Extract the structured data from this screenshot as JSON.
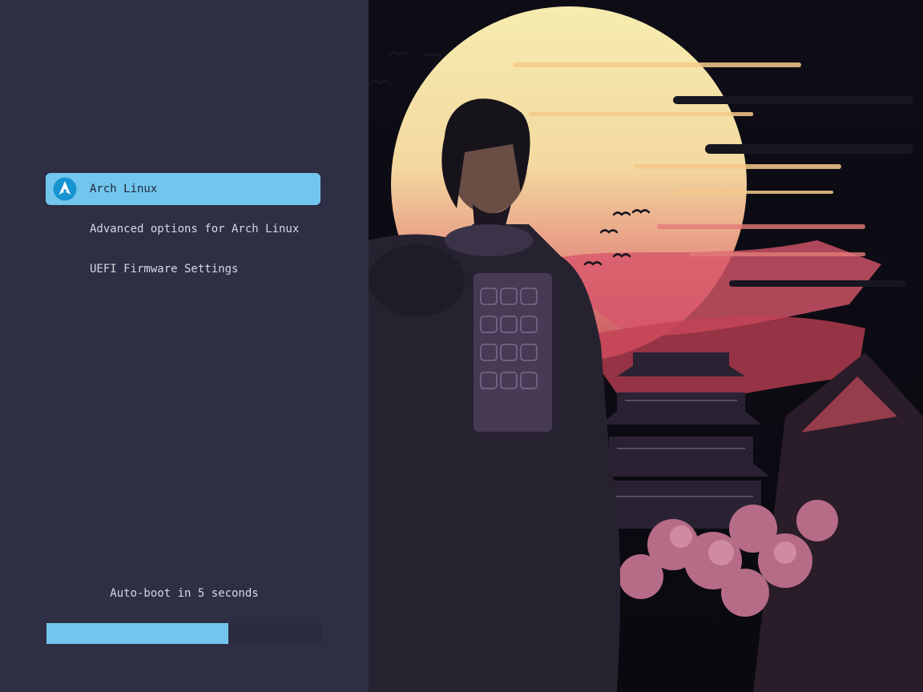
{
  "menu": {
    "selected_index": 0,
    "items": [
      {
        "label": "Arch Linux",
        "icon": "arch-linux-icon"
      },
      {
        "label": "Advanced options for Arch Linux"
      },
      {
        "label": "UEFI Firmware Settings"
      }
    ]
  },
  "autoboot": {
    "text": "Auto-boot in 5 seconds",
    "progress": 0.66
  },
  "colors": {
    "panel": "#2e2e44",
    "accent": "#72c6ee",
    "text": "#d6d8e2"
  },
  "wallpaper": {
    "subject": "samurai-with-pagoda-sunset"
  }
}
